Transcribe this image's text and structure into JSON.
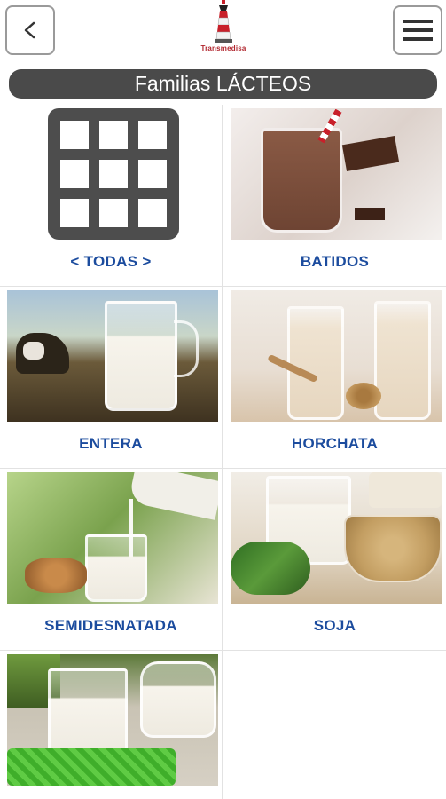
{
  "header": {
    "logo_text": "Transmedisa",
    "back_icon": "chevron-left-icon",
    "menu_icon": "hamburger-menu-icon"
  },
  "title": "Familias LÁCTEOS",
  "colors": {
    "title_bar_bg": "#4a4a4a",
    "label_color": "#1c4c9e"
  },
  "categories": [
    {
      "label": "< TODAS >",
      "image": "grid-icon"
    },
    {
      "label": "BATIDOS",
      "image": "chocolate-milkshake-photo"
    },
    {
      "label": "ENTERA",
      "image": "whole-milk-jug-photo"
    },
    {
      "label": "HORCHATA",
      "image": "horchata-glasses-photo"
    },
    {
      "label": "SEMIDESNATADA",
      "image": "semi-skimmed-milk-photo"
    },
    {
      "label": "SOJA",
      "image": "soy-milk-photo"
    },
    {
      "label": "",
      "image": "milk-glass-photo"
    }
  ]
}
